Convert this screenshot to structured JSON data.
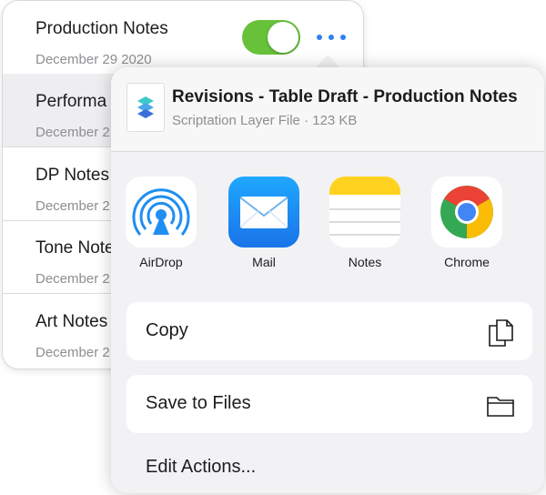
{
  "notes_list": {
    "items": [
      {
        "title": "Production Notes",
        "date": "December 29 2020"
      },
      {
        "title": "Performa",
        "date": "December 2"
      },
      {
        "title": "DP Notes",
        "date": "December 2"
      },
      {
        "title": "Tone Note",
        "date": "December 2"
      },
      {
        "title": "Art Notes",
        "date": "December 2"
      }
    ],
    "toggle_on": true,
    "accent_green": "#67c23a",
    "accent_blue": "#2f7ff0"
  },
  "share_sheet": {
    "file_name": "Revisions - Table Draft - Production Notes",
    "file_meta": "Scriptation Layer File · 123 KB",
    "apps": [
      {
        "label": "AirDrop",
        "icon": "airdrop-icon"
      },
      {
        "label": "Mail",
        "icon": "mail-icon"
      },
      {
        "label": "Notes",
        "icon": "notes-icon"
      },
      {
        "label": "Chrome",
        "icon": "chrome-icon"
      }
    ],
    "actions": [
      {
        "label": "Copy",
        "icon": "copy-icon"
      },
      {
        "label": "Save to Files",
        "icon": "folder-icon"
      }
    ],
    "edit_actions_label": "Edit Actions..."
  }
}
